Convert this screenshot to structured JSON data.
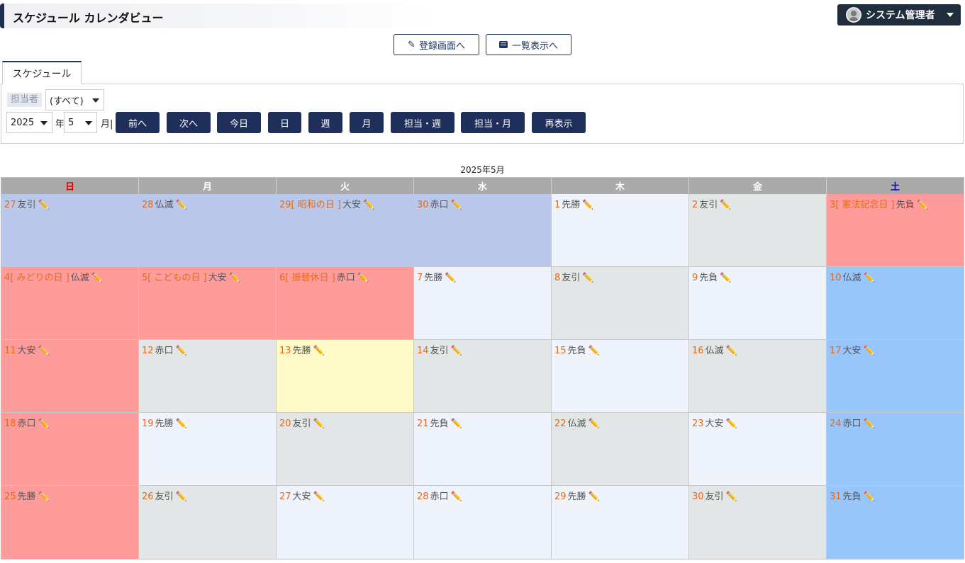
{
  "header": {
    "title": "スケジュール カレンダビュー",
    "user_name": "システム管理者"
  },
  "actions": {
    "register_label": "登録画面へ",
    "list_label": "一覧表示へ"
  },
  "tabs": [
    "スケジュール"
  ],
  "filter": {
    "assignee_label": "担当者",
    "assignee_value": "(すべて)",
    "year_value": "2025",
    "year_unit": "年",
    "month_value": "5",
    "month_unit": "月|",
    "buttons": [
      "前へ",
      "次へ",
      "今日",
      "日",
      "週",
      "月",
      "担当・週",
      "担当・月",
      "再表示"
    ]
  },
  "calendar": {
    "caption": "2025年5月",
    "weekdays": [
      "日",
      "月",
      "火",
      "水",
      "木",
      "金",
      "土"
    ],
    "colors": {
      "past": "#bac8ec",
      "holiday_weekend": "#fe9c9c",
      "saturday": "#98c6fb",
      "weekday_light": "#eff3fb",
      "weekday_grey": "#e2e6e6",
      "today": "#fffbc8",
      "date_text": "#e46a1a"
    },
    "weeks": [
      [
        {
          "day": "27",
          "holiday": "",
          "rokuyo": "友引",
          "bg": "past"
        },
        {
          "day": "28",
          "holiday": "",
          "rokuyo": "仏滅",
          "bg": "past"
        },
        {
          "day": "29",
          "holiday": "[ 昭和の日 ]",
          "rokuyo": "大安",
          "bg": "past"
        },
        {
          "day": "30",
          "holiday": "",
          "rokuyo": "赤口",
          "bg": "past"
        },
        {
          "day": "1",
          "holiday": "",
          "rokuyo": "先勝",
          "bg": "white"
        },
        {
          "day": "2",
          "holiday": "",
          "rokuyo": "友引",
          "bg": "grey"
        },
        {
          "day": "3",
          "holiday": "[ 憲法記念日 ]",
          "rokuyo": "先負",
          "bg": "red"
        }
      ],
      [
        {
          "day": "4",
          "holiday": "[ みどりの日 ]",
          "rokuyo": "仏滅",
          "bg": "red"
        },
        {
          "day": "5",
          "holiday": "[ こどもの日 ]",
          "rokuyo": "大安",
          "bg": "red"
        },
        {
          "day": "6",
          "holiday": "[ 振替休日 ]",
          "rokuyo": "赤口",
          "bg": "red"
        },
        {
          "day": "7",
          "holiday": "",
          "rokuyo": "先勝",
          "bg": "white"
        },
        {
          "day": "8",
          "holiday": "",
          "rokuyo": "友引",
          "bg": "grey"
        },
        {
          "day": "9",
          "holiday": "",
          "rokuyo": "先負",
          "bg": "white"
        },
        {
          "day": "10",
          "holiday": "",
          "rokuyo": "仏滅",
          "bg": "blue"
        }
      ],
      [
        {
          "day": "11",
          "holiday": "",
          "rokuyo": "大安",
          "bg": "red"
        },
        {
          "day": "12",
          "holiday": "",
          "rokuyo": "赤口",
          "bg": "grey"
        },
        {
          "day": "13",
          "holiday": "",
          "rokuyo": "先勝",
          "bg": "yellow"
        },
        {
          "day": "14",
          "holiday": "",
          "rokuyo": "友引",
          "bg": "grey"
        },
        {
          "day": "15",
          "holiday": "",
          "rokuyo": "先負",
          "bg": "white"
        },
        {
          "day": "16",
          "holiday": "",
          "rokuyo": "仏滅",
          "bg": "grey"
        },
        {
          "day": "17",
          "holiday": "",
          "rokuyo": "大安",
          "bg": "blue"
        }
      ],
      [
        {
          "day": "18",
          "holiday": "",
          "rokuyo": "赤口",
          "bg": "red"
        },
        {
          "day": "19",
          "holiday": "",
          "rokuyo": "先勝",
          "bg": "white"
        },
        {
          "day": "20",
          "holiday": "",
          "rokuyo": "友引",
          "bg": "grey"
        },
        {
          "day": "21",
          "holiday": "",
          "rokuyo": "先負",
          "bg": "white"
        },
        {
          "day": "22",
          "holiday": "",
          "rokuyo": "仏滅",
          "bg": "grey"
        },
        {
          "day": "23",
          "holiday": "",
          "rokuyo": "大安",
          "bg": "white"
        },
        {
          "day": "24",
          "holiday": "",
          "rokuyo": "赤口",
          "bg": "blue"
        }
      ],
      [
        {
          "day": "25",
          "holiday": "",
          "rokuyo": "先勝",
          "bg": "red"
        },
        {
          "day": "26",
          "holiday": "",
          "rokuyo": "友引",
          "bg": "grey"
        },
        {
          "day": "27",
          "holiday": "",
          "rokuyo": "大安",
          "bg": "white"
        },
        {
          "day": "28",
          "holiday": "",
          "rokuyo": "赤口",
          "bg": "white"
        },
        {
          "day": "29",
          "holiday": "",
          "rokuyo": "先勝",
          "bg": "white"
        },
        {
          "day": "30",
          "holiday": "",
          "rokuyo": "友引",
          "bg": "grey"
        },
        {
          "day": "31",
          "holiday": "",
          "rokuyo": "先負",
          "bg": "blue"
        }
      ]
    ]
  }
}
